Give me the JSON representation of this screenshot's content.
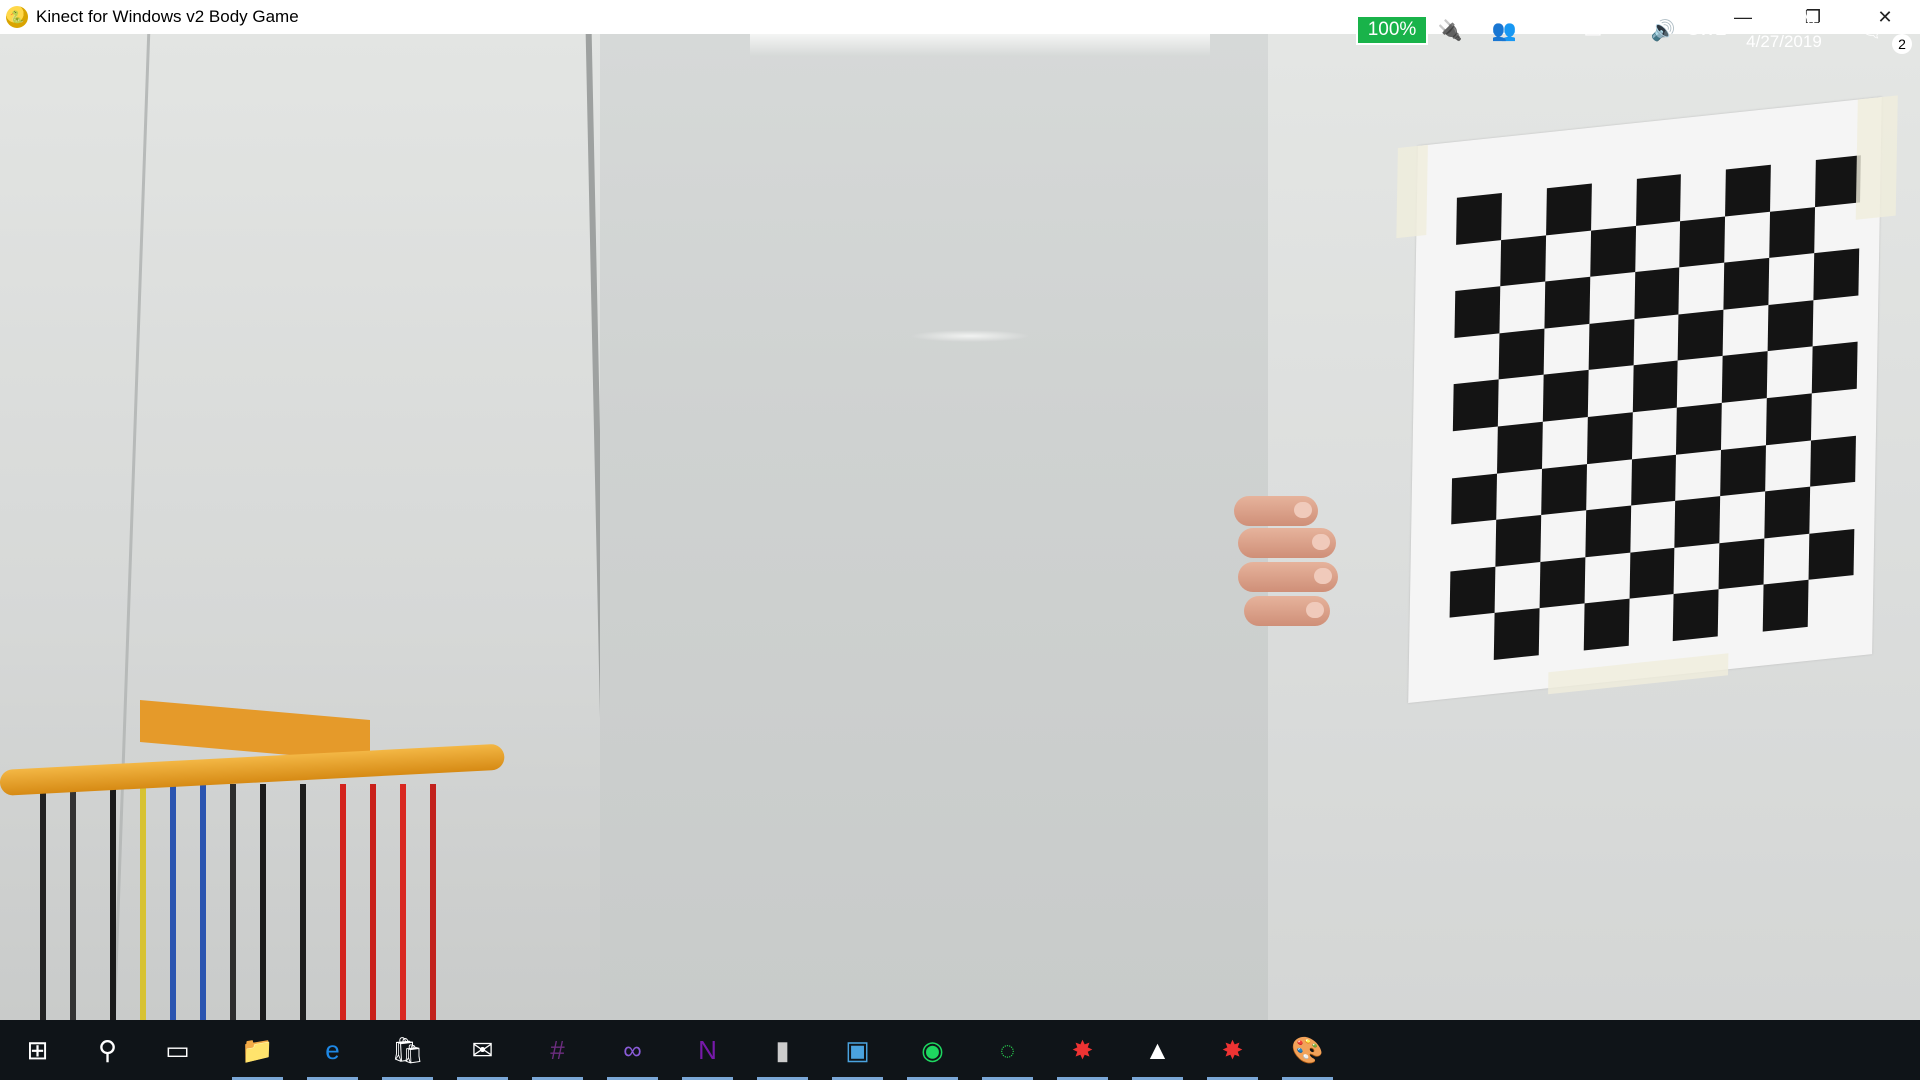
{
  "window": {
    "title": "Kinect for Windows v2 Body Game",
    "controls": {
      "minimize": "—",
      "maximize": "❐",
      "close": "✕"
    }
  },
  "taskbar": {
    "apps": [
      {
        "name": "start",
        "icon": "windows-logo-icon",
        "glyph": "⊞"
      },
      {
        "name": "search",
        "icon": "search-icon",
        "glyph": "⚲"
      },
      {
        "name": "task-view",
        "icon": "task-view-icon",
        "glyph": "▭"
      },
      {
        "name": "file-explorer",
        "icon": "folder-icon",
        "glyph": "📁"
      },
      {
        "name": "edge",
        "icon": "edge-icon",
        "glyph": "e"
      },
      {
        "name": "store",
        "icon": "store-icon",
        "glyph": "🛍"
      },
      {
        "name": "mail",
        "icon": "mail-icon",
        "glyph": "✉"
      },
      {
        "name": "slack",
        "icon": "slack-icon",
        "glyph": "#"
      },
      {
        "name": "visual-studio",
        "icon": "visual-studio-icon",
        "glyph": "∞"
      },
      {
        "name": "onenote",
        "icon": "onenote-icon",
        "glyph": "N"
      },
      {
        "name": "terminal",
        "icon": "terminal-icon",
        "glyph": "▮"
      },
      {
        "name": "control-panel",
        "icon": "control-panel-icon",
        "glyph": "▣"
      },
      {
        "name": "spotify",
        "icon": "spotify-icon",
        "glyph": "◉"
      },
      {
        "name": "progress-app",
        "icon": "loading-ring-icon",
        "glyph": "◌"
      },
      {
        "name": "kinect-app-1",
        "icon": "spider-web-icon",
        "glyph": "✸"
      },
      {
        "name": "photos",
        "icon": "photos-icon",
        "glyph": "▲"
      },
      {
        "name": "kinect-app-2",
        "icon": "spider-web-icon",
        "glyph": "✸"
      },
      {
        "name": "paint",
        "icon": "paint-palette-icon",
        "glyph": "🎨"
      }
    ],
    "battery": "100%",
    "language": "SWE",
    "time": "3:59 PM",
    "date": "4/27/2019",
    "notification_count": "2"
  }
}
